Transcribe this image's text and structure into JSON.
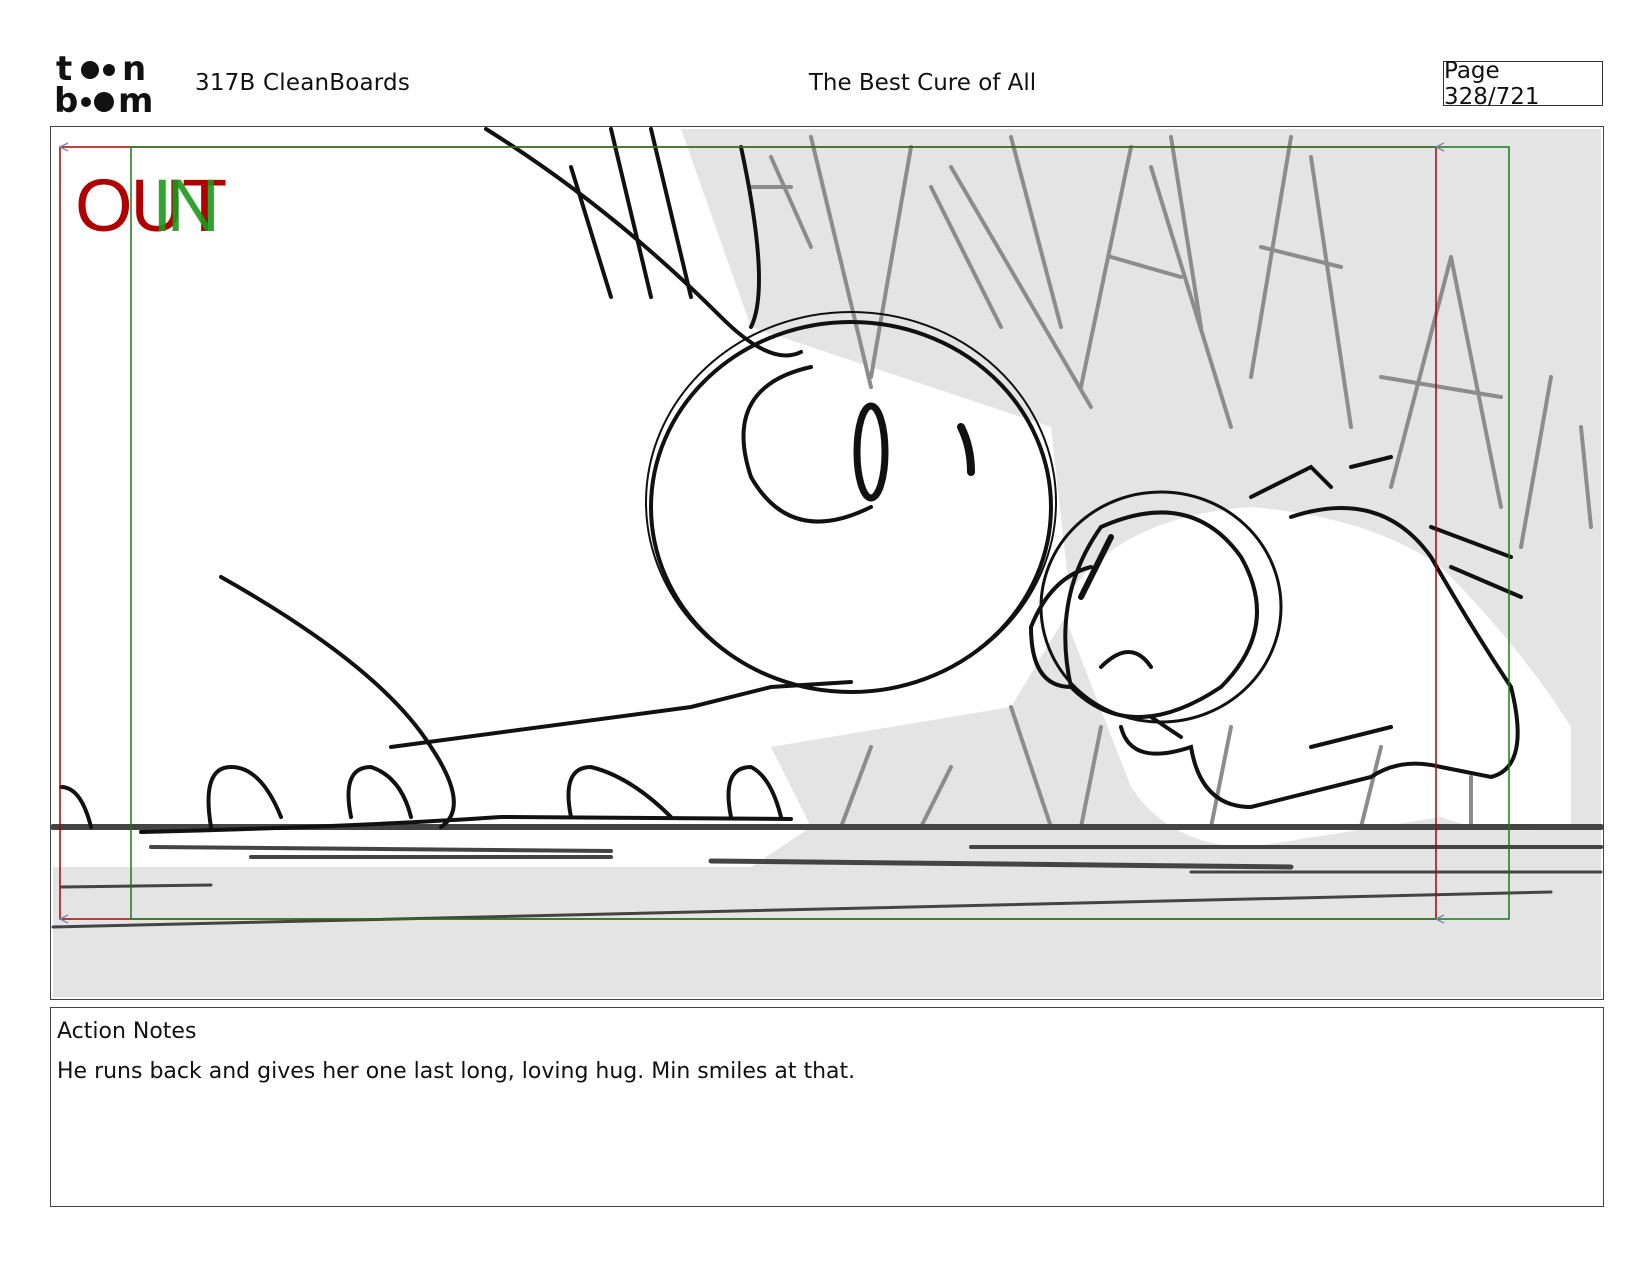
{
  "header": {
    "logo_text": "toon boom",
    "project_label": "317B  CleanBoards",
    "episode_title": "The Best Cure of All",
    "page_indicator": "Page 328/721"
  },
  "panel": {
    "transition_out": "OUT",
    "transition_in": "IN",
    "colors": {
      "out": "#b00000",
      "in": "#1a9a1a",
      "safe_frame": "#b00000",
      "camera_frame": "#1a7a1a",
      "background": "#e4e4e4"
    }
  },
  "notes": {
    "title": "Action Notes",
    "text": "He runs back and gives her one last long, loving hug. Min smiles at that."
  }
}
